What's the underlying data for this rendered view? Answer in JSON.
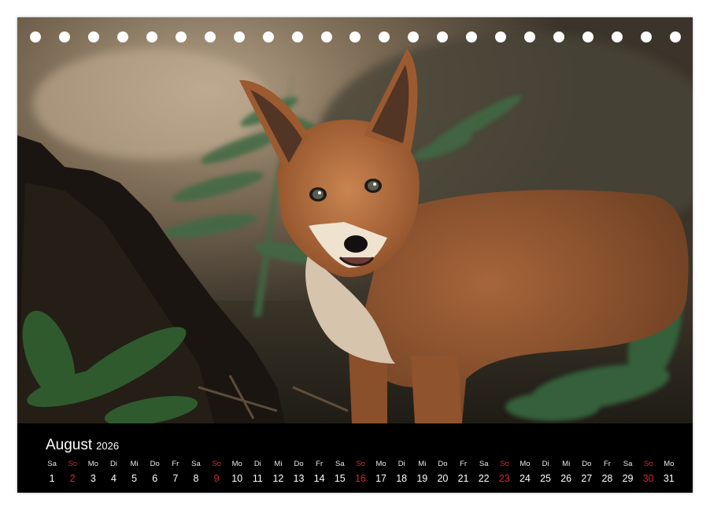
{
  "calendar": {
    "month": "August",
    "year": "2026",
    "sunday_color": "#d8262a",
    "days": [
      {
        "wd": "Sa",
        "d": "1",
        "sun": false
      },
      {
        "wd": "So",
        "d": "2",
        "sun": true
      },
      {
        "wd": "Mo",
        "d": "3",
        "sun": false
      },
      {
        "wd": "Di",
        "d": "4",
        "sun": false
      },
      {
        "wd": "Mi",
        "d": "5",
        "sun": false
      },
      {
        "wd": "Do",
        "d": "6",
        "sun": false
      },
      {
        "wd": "Fr",
        "d": "7",
        "sun": false
      },
      {
        "wd": "Sa",
        "d": "8",
        "sun": false
      },
      {
        "wd": "So",
        "d": "9",
        "sun": true
      },
      {
        "wd": "Mo",
        "d": "10",
        "sun": false
      },
      {
        "wd": "Di",
        "d": "11",
        "sun": false
      },
      {
        "wd": "Mi",
        "d": "12",
        "sun": false
      },
      {
        "wd": "Do",
        "d": "13",
        "sun": false
      },
      {
        "wd": "Fr",
        "d": "14",
        "sun": false
      },
      {
        "wd": "Sa",
        "d": "15",
        "sun": false
      },
      {
        "wd": "So",
        "d": "16",
        "sun": true
      },
      {
        "wd": "Mo",
        "d": "17",
        "sun": false
      },
      {
        "wd": "Di",
        "d": "18",
        "sun": false
      },
      {
        "wd": "Mi",
        "d": "19",
        "sun": false
      },
      {
        "wd": "Do",
        "d": "20",
        "sun": false
      },
      {
        "wd": "Fr",
        "d": "21",
        "sun": false
      },
      {
        "wd": "Sa",
        "d": "22",
        "sun": false
      },
      {
        "wd": "So",
        "d": "23",
        "sun": true
      },
      {
        "wd": "Mo",
        "d": "24",
        "sun": false
      },
      {
        "wd": "Di",
        "d": "25",
        "sun": false
      },
      {
        "wd": "Mi",
        "d": "26",
        "sun": false
      },
      {
        "wd": "Do",
        "d": "27",
        "sun": false
      },
      {
        "wd": "Fr",
        "d": "28",
        "sun": false
      },
      {
        "wd": "Sa",
        "d": "29",
        "sun": false
      },
      {
        "wd": "So",
        "d": "30",
        "sun": true
      },
      {
        "wd": "Mo",
        "d": "31",
        "sun": false
      }
    ]
  },
  "binding_holes": {
    "count": 23
  }
}
